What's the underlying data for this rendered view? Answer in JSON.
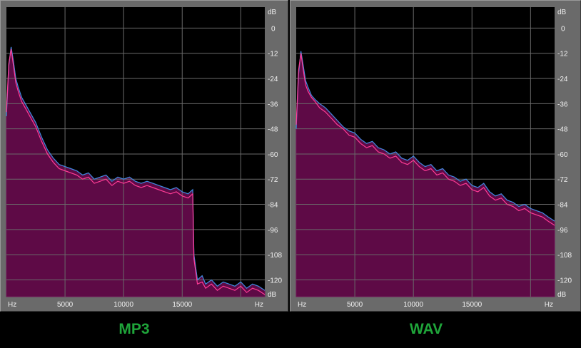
{
  "captions": {
    "left": "MP3",
    "right": "WAV"
  },
  "colors": {
    "plot_bg": "#000000",
    "fill": "#5e0a46",
    "fill_stroke": "#6e1456",
    "line_blue": "#3d8be0",
    "line_pink": "#ff3c96",
    "grid": "#6a6a6a",
    "panel": "#6a6a6a",
    "caption": "#1fa53a"
  },
  "chart_data": [
    {
      "type": "area",
      "title": "MP3",
      "xlabel": "Hz",
      "ylabel": "dB",
      "xlim": [
        0,
        22050
      ],
      "ylim": [
        -128,
        10
      ],
      "x_ticks": [
        "5000",
        "10000",
        "15000"
      ],
      "x_tick_values": [
        5000,
        10000,
        15000
      ],
      "x_end_label": "Hz",
      "y_ticks": [
        0,
        -12,
        -24,
        -36,
        -48,
        -60,
        -72,
        -84,
        -96,
        -108,
        -120
      ],
      "y_tick_labels": [
        "0",
        "-12",
        "-24",
        "-36",
        "-48",
        "-60",
        "-72",
        "-84",
        "-96",
        "-108",
        "-120"
      ],
      "y_top_label": "dB",
      "y_bottom_label": "dB",
      "x_vertical_gridlines": [
        5000,
        10000,
        15000,
        20000
      ],
      "grid": true,
      "series": [
        {
          "color": "blue",
          "x": [
            0,
            200,
            400,
            600,
            800,
            1000,
            1300,
            1600,
            2000,
            2500,
            3000,
            3500,
            4000,
            4500,
            5000,
            5500,
            6000,
            6500,
            7000,
            7500,
            8000,
            8500,
            9000,
            9500,
            10000,
            10500,
            11000,
            11500,
            12000,
            12500,
            13000,
            13500,
            14000,
            14500,
            15000,
            15500,
            15900,
            16000,
            16300,
            16700,
            17000,
            17500,
            18000,
            18500,
            19000,
            19500,
            20000,
            20500,
            21000,
            21500,
            22050
          ],
          "values": [
            -42,
            -18,
            -9,
            -16,
            -24,
            -28,
            -33,
            -36,
            -40,
            -45,
            -52,
            -58,
            -62,
            -65,
            -66,
            -67,
            -68,
            -70,
            -69,
            -72,
            -71,
            -70,
            -73,
            -71,
            -72,
            -71,
            -73,
            -74,
            -73,
            -74,
            -75,
            -76,
            -77,
            -76,
            -78,
            -79,
            -77,
            -108,
            -120,
            -118,
            -122,
            -120,
            -123,
            -121,
            -122,
            -123,
            -121,
            -124,
            -122,
            -123,
            -125
          ]
        },
        {
          "color": "pink",
          "x": [
            0,
            200,
            400,
            600,
            800,
            1000,
            1300,
            1600,
            2000,
            2500,
            3000,
            3500,
            4000,
            4500,
            5000,
            5500,
            6000,
            6500,
            7000,
            7500,
            8000,
            8500,
            9000,
            9500,
            10000,
            10500,
            11000,
            11500,
            12000,
            12500,
            13000,
            13500,
            14000,
            14500,
            15000,
            15500,
            15900,
            16000,
            16300,
            16700,
            17000,
            17500,
            18000,
            18500,
            19000,
            19500,
            20000,
            20500,
            21000,
            21500,
            22050
          ],
          "values": [
            -40,
            -17,
            -10,
            -18,
            -26,
            -30,
            -35,
            -38,
            -42,
            -47,
            -54,
            -60,
            -64,
            -67,
            -68,
            -69,
            -70,
            -72,
            -71,
            -74,
            -73,
            -72,
            -75,
            -73,
            -74,
            -73,
            -75,
            -76,
            -75,
            -76,
            -77,
            -78,
            -79,
            -78,
            -80,
            -81,
            -79,
            -110,
            -122,
            -121,
            -124,
            -122,
            -125,
            -123,
            -124,
            -125,
            -123,
            -126,
            -124,
            -125,
            -127
          ]
        }
      ]
    },
    {
      "type": "area",
      "title": "WAV",
      "xlabel": "Hz",
      "ylabel": "dB",
      "xlim": [
        0,
        22050
      ],
      "ylim": [
        -128,
        10
      ],
      "x_ticks": [
        "5000",
        "10000",
        "15000"
      ],
      "x_tick_values": [
        5000,
        10000,
        15000
      ],
      "x_end_label": "Hz",
      "y_ticks": [
        0,
        -12,
        -24,
        -36,
        -48,
        -60,
        -72,
        -84,
        -96,
        -108,
        -120
      ],
      "y_tick_labels": [
        "0",
        "-12",
        "-24",
        "-36",
        "-48",
        "-60",
        "-72",
        "-84",
        "-96",
        "-108",
        "-120"
      ],
      "y_top_label": "dB",
      "y_bottom_label": "dB",
      "x_vertical_gridlines": [
        5000,
        10000,
        15000,
        20000
      ],
      "grid": true,
      "series": [
        {
          "color": "blue",
          "x": [
            0,
            200,
            400,
            600,
            800,
            1000,
            1300,
            1600,
            2000,
            2500,
            3000,
            3500,
            4000,
            4500,
            5000,
            5500,
            6000,
            6500,
            7000,
            7500,
            8000,
            8500,
            9000,
            9500,
            10000,
            10500,
            11000,
            11500,
            12000,
            12500,
            13000,
            13500,
            14000,
            14500,
            15000,
            15500,
            16000,
            16500,
            17000,
            17500,
            18000,
            18500,
            19000,
            19500,
            20000,
            20500,
            21000,
            21500,
            22050
          ],
          "values": [
            -48,
            -22,
            -11,
            -18,
            -25,
            -28,
            -32,
            -34,
            -36,
            -38,
            -41,
            -44,
            -47,
            -49,
            -50,
            -53,
            -55,
            -54,
            -57,
            -58,
            -60,
            -59,
            -62,
            -63,
            -61,
            -64,
            -66,
            -65,
            -68,
            -67,
            -70,
            -71,
            -73,
            -72,
            -75,
            -76,
            -74,
            -78,
            -80,
            -79,
            -82,
            -83,
            -85,
            -84,
            -86,
            -87,
            -88,
            -90,
            -92
          ]
        },
        {
          "color": "pink",
          "x": [
            0,
            200,
            400,
            600,
            800,
            1000,
            1300,
            1600,
            2000,
            2500,
            3000,
            3500,
            4000,
            4500,
            5000,
            5500,
            6000,
            6500,
            7000,
            7500,
            8000,
            8500,
            9000,
            9500,
            10000,
            10500,
            11000,
            11500,
            12000,
            12500,
            13000,
            13500,
            14000,
            14500,
            15000,
            15500,
            16000,
            16500,
            17000,
            17500,
            18000,
            18500,
            19000,
            19500,
            20000,
            20500,
            21000,
            21500,
            22050
          ],
          "values": [
            -46,
            -20,
            -12,
            -20,
            -27,
            -30,
            -33,
            -35,
            -38,
            -40,
            -43,
            -46,
            -48,
            -51,
            -52,
            -55,
            -57,
            -56,
            -59,
            -60,
            -62,
            -61,
            -64,
            -65,
            -63,
            -66,
            -68,
            -67,
            -70,
            -69,
            -72,
            -73,
            -75,
            -74,
            -77,
            -78,
            -76,
            -80,
            -82,
            -81,
            -84,
            -85,
            -87,
            -86,
            -88,
            -89,
            -90,
            -92,
            -94
          ]
        }
      ]
    }
  ]
}
